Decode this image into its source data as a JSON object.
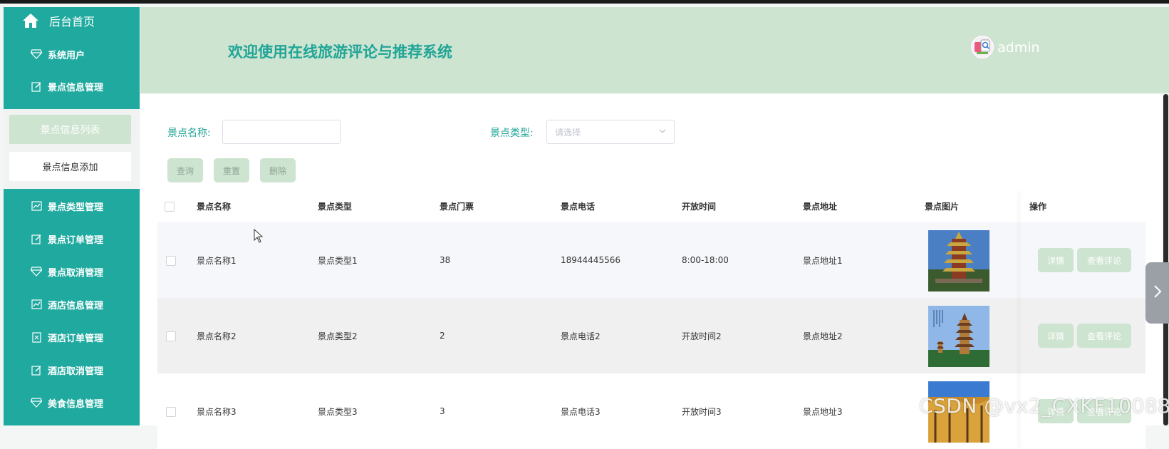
{
  "sidebar": {
    "home": "后台首页",
    "items": [
      {
        "label": "系统用户",
        "icon": "diamond-icon"
      },
      {
        "label": "景点信息管理",
        "icon": "edit-icon"
      },
      {
        "label": "景点类型管理",
        "icon": "chart-icon"
      },
      {
        "label": "景点订单管理",
        "icon": "edit-icon"
      },
      {
        "label": "景点取消管理",
        "icon": "diamond-icon"
      },
      {
        "label": "酒店信息管理",
        "icon": "chart-icon"
      },
      {
        "label": "酒店订单管理",
        "icon": "document-icon"
      },
      {
        "label": "酒店取消管理",
        "icon": "edit-icon"
      },
      {
        "label": "美食信息管理",
        "icon": "diamond-icon"
      }
    ],
    "submenu": {
      "active": "景点信息列表",
      "other": "景点信息添加"
    }
  },
  "header": {
    "title": "欢迎使用在线旅游评论与推荐系统",
    "user": "admin"
  },
  "search": {
    "name_label": "景点名称:",
    "type_label": "景点类型:",
    "type_placeholder": "请选择",
    "query": "查询",
    "reset": "重置",
    "delete": "删除"
  },
  "table": {
    "headers": [
      "景点名称",
      "景点类型",
      "景点门票",
      "景点电话",
      "开放时间",
      "景点地址",
      "景点图片",
      "操作"
    ],
    "rows": [
      {
        "name": "景点名称1",
        "type": "景点类型1",
        "ticket": "38",
        "phone": "18944445566",
        "hours": "8:00-18:00",
        "address": "景点地址1"
      },
      {
        "name": "景点名称2",
        "type": "景点类型2",
        "ticket": "2",
        "phone": "景点电话2",
        "hours": "开放时间2",
        "address": "景点地址2"
      },
      {
        "name": "景点名称3",
        "type": "景点类型3",
        "ticket": "3",
        "phone": "景点电话3",
        "hours": "开放时间3",
        "address": "景点地址3"
      }
    ],
    "detail_label": "详情",
    "comments_label": "查看评论"
  },
  "watermark": "CSDN @vx2_CXKF10088",
  "colors": {
    "sidebar": "#1fa99f",
    "header": "#cde4d0",
    "accent_text": "#20a597",
    "button": "#cde4d0"
  }
}
